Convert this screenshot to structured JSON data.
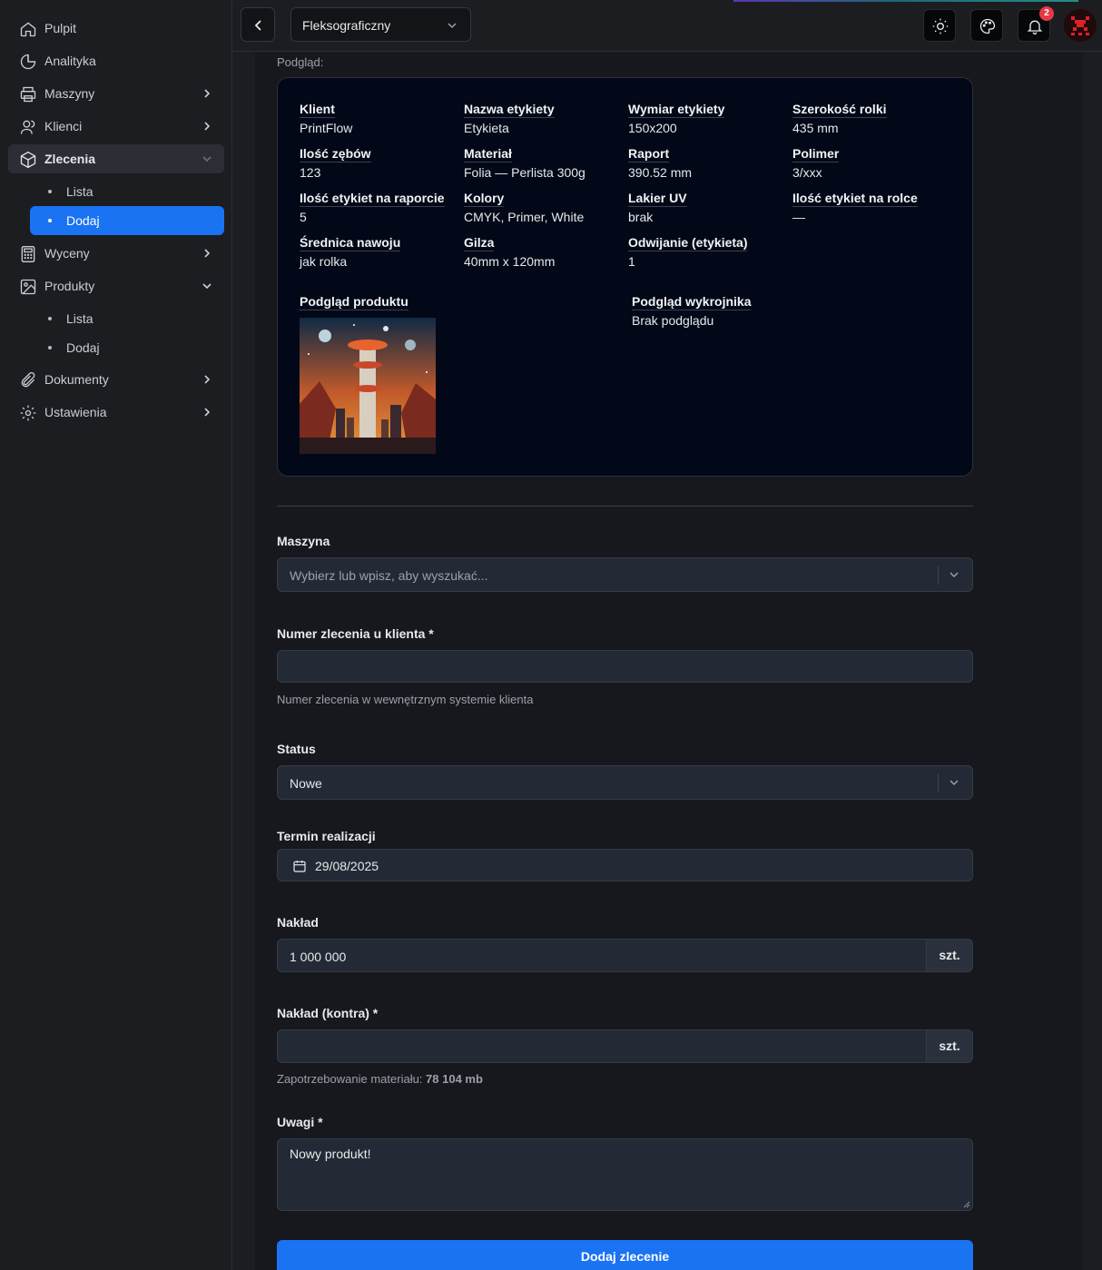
{
  "sidebar": {
    "items": [
      {
        "label": "Pulpit"
      },
      {
        "label": "Analityka"
      },
      {
        "label": "Maszyny"
      },
      {
        "label": "Klienci"
      },
      {
        "label": "Zlecenia"
      },
      {
        "label": "Wyceny"
      },
      {
        "label": "Produkty"
      },
      {
        "label": "Dokumenty"
      },
      {
        "label": "Ustawienia"
      }
    ],
    "zlecenia_sub": [
      {
        "label": "Lista"
      },
      {
        "label": "Dodaj"
      }
    ],
    "produkty_sub": [
      {
        "label": "Lista"
      },
      {
        "label": "Dodaj"
      }
    ]
  },
  "topbar": {
    "mode": "Fleksograficzny",
    "notifications_count": "2"
  },
  "preview": {
    "heading": "Podgląd:",
    "fields": [
      {
        "k": "Klient",
        "v": "PrintFlow"
      },
      {
        "k": "Nazwa etykiety",
        "v": "Etykieta"
      },
      {
        "k": "Wymiar etykiety",
        "v": "150x200"
      },
      {
        "k": "Szerokość rolki",
        "v": "435 mm"
      },
      {
        "k": "Ilość zębów",
        "v": "123"
      },
      {
        "k": "Materiał",
        "v": "Folia — Perlista 300g"
      },
      {
        "k": "Raport",
        "v": "390.52 mm"
      },
      {
        "k": "Polimer",
        "v": "3/xxx"
      },
      {
        "k": "Ilość etykiet na raporcie",
        "v": "5"
      },
      {
        "k": "Kolory",
        "v": "CMYK, Primer, White"
      },
      {
        "k": "Lakier UV",
        "v": "brak"
      },
      {
        "k": "Ilość etykiet na rolce",
        "v": "—"
      },
      {
        "k": "Średnica nawoju",
        "v": "jak rolka"
      },
      {
        "k": "Gilza",
        "v": "40mm x 120mm"
      },
      {
        "k": "Odwijanie (etykieta)",
        "v": "1"
      }
    ],
    "product_preview_label": "Podgląd produktu",
    "die_preview_label": "Podgląd wykrojnika",
    "die_preview_value": "Brak podglądu"
  },
  "form": {
    "machine_label": "Maszyna",
    "machine_placeholder": "Wybierz lub wpisz, aby wyszukać...",
    "order_number_label": "Numer zlecenia u klienta *",
    "order_number_value": "",
    "order_number_hint": "Numer zlecenia w wewnętrznym systemie klienta",
    "status_label": "Status",
    "status_value": "Nowe",
    "deadline_label": "Termin realizacji",
    "deadline_value": "29/08/2025",
    "quantity_label": "Nakład",
    "quantity_value": "1 000 000",
    "quantity_unit": "szt.",
    "quantity_contra_label": "Nakład (kontra) *",
    "quantity_contra_value": "",
    "quantity_contra_unit": "szt.",
    "material_need_prefix": "Zapotrzebowanie materiału:",
    "material_need_value": "78 104 mb",
    "notes_label": "Uwagi *",
    "notes_value": "Nowy produkt!",
    "submit_label": "Dodaj zlecenie"
  },
  "colors": {
    "accent": "#1a73f3",
    "badge": "#e53946"
  }
}
